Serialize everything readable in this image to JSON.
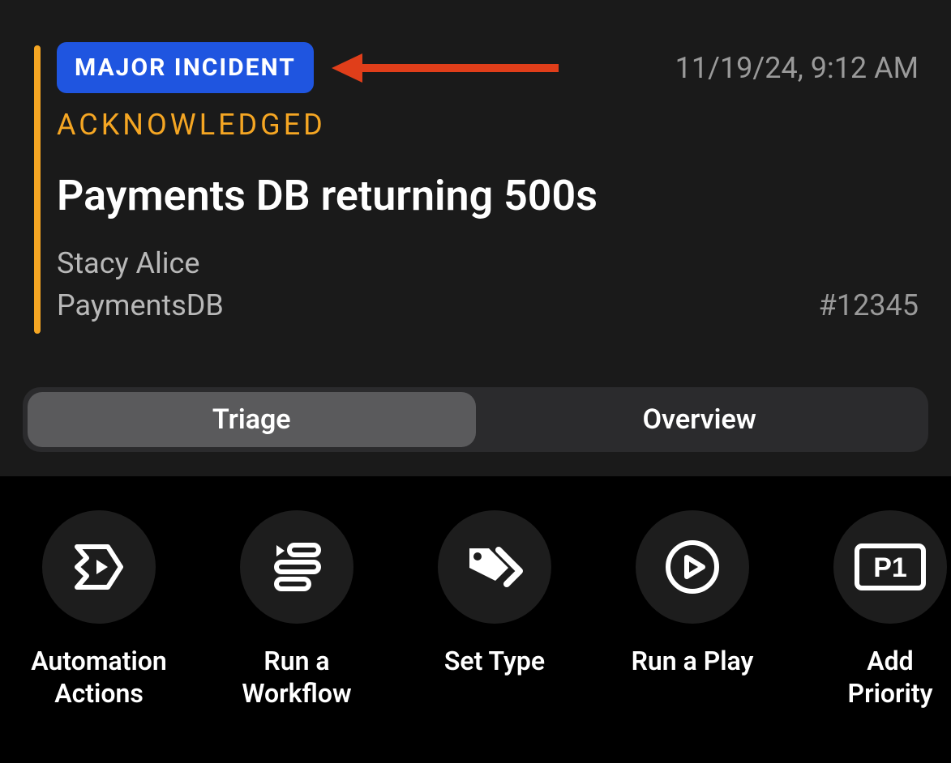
{
  "incident": {
    "badge": "MAJOR INCIDENT",
    "timestamp": "11/19/24, 9:12 AM",
    "status": "ACKNOWLEDGED",
    "title": "Payments DB returning 500s",
    "assignee": "Stacy Alice",
    "service": "PaymentsDB",
    "number": "#12345",
    "accent_color": "#f5a623",
    "badge_color": "#1f55e0"
  },
  "tabs": {
    "items": [
      {
        "label": "Triage",
        "active": true
      },
      {
        "label": "Overview",
        "active": false
      }
    ]
  },
  "actions": {
    "items": [
      {
        "label": "Automation\nActions",
        "icon": "automation-actions-icon"
      },
      {
        "label": "Run a\nWorkflow",
        "icon": "run-workflow-icon"
      },
      {
        "label": "Set Type",
        "icon": "set-type-icon"
      },
      {
        "label": "Run a Play",
        "icon": "run-play-icon"
      },
      {
        "label": "Add\nPriority",
        "icon": "add-priority-icon"
      }
    ]
  },
  "annotation": {
    "arrow_color": "#e03e1a"
  }
}
